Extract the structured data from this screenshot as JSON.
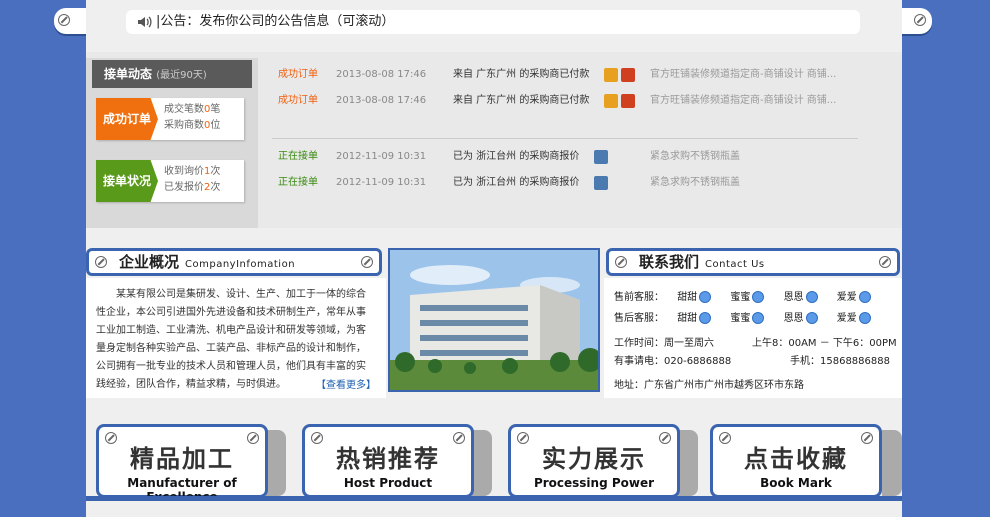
{
  "notice": {
    "text": "|公告：发布你公司的公告信息（可滚动）"
  },
  "orders": {
    "heading": "接单动态",
    "heading_sub": "(最近90天)",
    "tabs": [
      {
        "label": "成功订单",
        "line1": "成交笔数",
        "n1": "0",
        "u1": "笔",
        "line2": "采购商数",
        "n2": "0",
        "u2": "位",
        "color": "#f07010"
      },
      {
        "label": "接单状况",
        "line1": "收到询价",
        "n1": "1",
        "u1": "次",
        "line2": "已发报价",
        "n2": "2",
        "u2": "次",
        "color": "#5a9a1a"
      }
    ],
    "rows": [
      {
        "status": "成功订单",
        "date": "2013-08-08 17:46",
        "msg": "来自 广东广州 的采购商已付款",
        "desc": "官方旺铺装修频道指定商-商铺设计 商铺..."
      },
      {
        "status": "成功订单",
        "date": "2013-08-08 17:46",
        "msg": "来自 广东广州 的采购商已付款",
        "desc": "官方旺铺装修频道指定商-商铺设计 商铺..."
      },
      {
        "status": "正在接单",
        "date": "2012-11-09 10:31",
        "msg": "已为 浙江台州 的采购商报价",
        "desc": "紧急求购不锈钢瓶盖"
      },
      {
        "status": "正在接单",
        "date": "2012-11-09 10:31",
        "msg": "已为 浙江台州 的采购商报价",
        "desc": "紧急求购不锈钢瓶盖"
      }
    ],
    "colors": {
      "success": "#f06010",
      "pending": "#3a8a10"
    }
  },
  "about": {
    "title": "企业概况",
    "title_en": "CompanyInfomation",
    "body": "某某有限公司是集研发、设计、生产、加工于一体的综合性企业，本公司引进国外先进设备和技术研制生产，常年从事工业加工制造、工业清洗、机电产品设计和研发等领域，为客量身定制各种实验产品、工装产品、非标产品的设计和制作，公司拥有一批专业的技术人员和管理人员，他们具有丰富的实践经验，团队合作，精益求精，与时俱进。",
    "more": "【查看更多】"
  },
  "contact": {
    "title": "联系我们",
    "title_en": "Contact Us",
    "presale_label": "售前客服：",
    "postsale_label": "售后客服：",
    "agents": [
      "甜甜",
      "蜜蜜",
      "恩恩",
      "爱爱"
    ],
    "hours_label": "工作时间：周一至周六",
    "hours_value": "上午8：00AM － 下午6：00PM",
    "phone_label": "有事请电：020-6886888",
    "mobile_label": "手机：15868886888",
    "address": "地址：广东省广州市广州市越秀区环市东路"
  },
  "cards": [
    {
      "title": "精品加工",
      "subtitle": "Manufacturer of Excellence"
    },
    {
      "title": "热销推荐",
      "subtitle": "Host Product"
    },
    {
      "title": "实力展示",
      "subtitle": "Processing Power"
    },
    {
      "title": "点击收藏",
      "subtitle": "Book Mark"
    }
  ],
  "icons": [
    "speaker-icon",
    "screw-icon",
    "cheng-badge-icon",
    "verified-icon",
    "qq-icon"
  ]
}
